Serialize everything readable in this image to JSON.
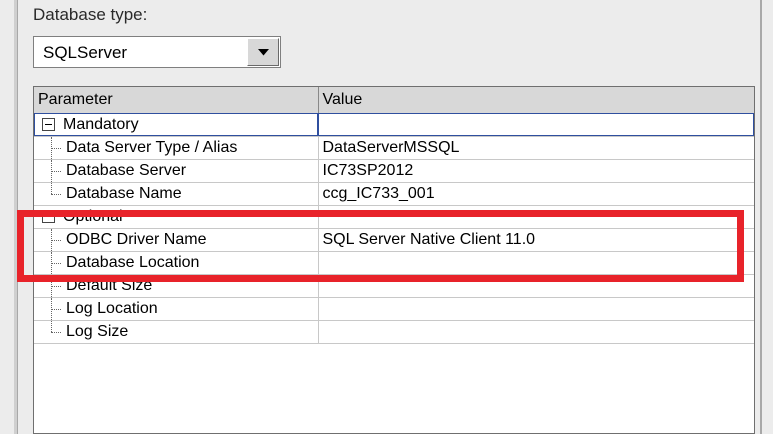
{
  "database_type": {
    "label": "Database type:",
    "selected": "SQLServer"
  },
  "grid": {
    "headers": [
      "Parameter",
      "Value"
    ],
    "sections": [
      {
        "label": "Mandatory",
        "rows": [
          {
            "param": "Data Server Type / Alias",
            "value": "DataServerMSSQL"
          },
          {
            "param": "Database Server",
            "value": "IC73SP2012"
          },
          {
            "param": "Database Name",
            "value": "ccg_IC733_001"
          }
        ]
      },
      {
        "label": "Optional",
        "rows": [
          {
            "param": "ODBC Driver Name",
            "value": "SQL Server Native Client 11.0"
          },
          {
            "param": "Database Location",
            "value": ""
          },
          {
            "param": "Default Size",
            "value": ""
          },
          {
            "param": "Log Location",
            "value": ""
          },
          {
            "param": "Log Size",
            "value": ""
          }
        ]
      }
    ]
  },
  "colors": {
    "highlight": "#e8232a"
  }
}
